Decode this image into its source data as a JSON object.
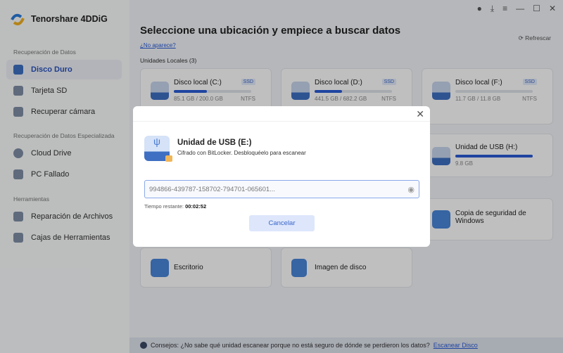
{
  "app": {
    "name": "Tenorshare 4DDiG"
  },
  "sidebar": {
    "sections": [
      "Recuperación de Datos",
      "Recuperación de Datos Especializada",
      "Herramientas"
    ],
    "items": [
      "Disco Duro",
      "Tarjeta SD",
      "Recuperar cámara",
      "Cloud Drive",
      "PC Fallado",
      "Reparación de Archivos",
      "Cajas de Herramientas"
    ]
  },
  "main": {
    "title": "Seleccione una ubicación y empiece a buscar datos",
    "not_found": "¿No aparece?",
    "refresh": "Refrescar",
    "local_label": "Unidades Locales (3)",
    "drives": [
      {
        "name": "Disco local (C:)",
        "badge": "SSD",
        "size": "85.1 GB / 200.0 GB",
        "fs": "NTFS",
        "used": 0.43
      },
      {
        "name": "Disco local (D:)",
        "badge": "SSD",
        "size": "441.5 GB / 682.2 GB",
        "fs": "NTFS",
        "used": 0.35
      },
      {
        "name": "Disco local (F:)",
        "badge": "SSD",
        "size": "11.7 GB / 11.8 GB",
        "fs": "NTFS",
        "used": 0.0
      }
    ],
    "usb_h": {
      "name": "Unidad de USB (H:)",
      "size": "9.8 GB",
      "used": 1.0
    },
    "backup": "Copia de seguridad de Windows",
    "desktop": "Escritorio",
    "disk_image": "Imagen de disco",
    "tips": {
      "text": "Consejos: ¿No sabe qué unidad escanear porque no está seguro de dónde se perdieron los datos?",
      "link": "Escanear Disco"
    }
  },
  "modal": {
    "title": "Unidad de USB (E:)",
    "desc": "Cifrado con BitLocker. Desbloquéelo para escanear",
    "key": "994866-439787-158702-794701-065601...",
    "timer_label": "Tiempo restante:",
    "timer": "00:02:52",
    "cancel": "Cancelar"
  }
}
